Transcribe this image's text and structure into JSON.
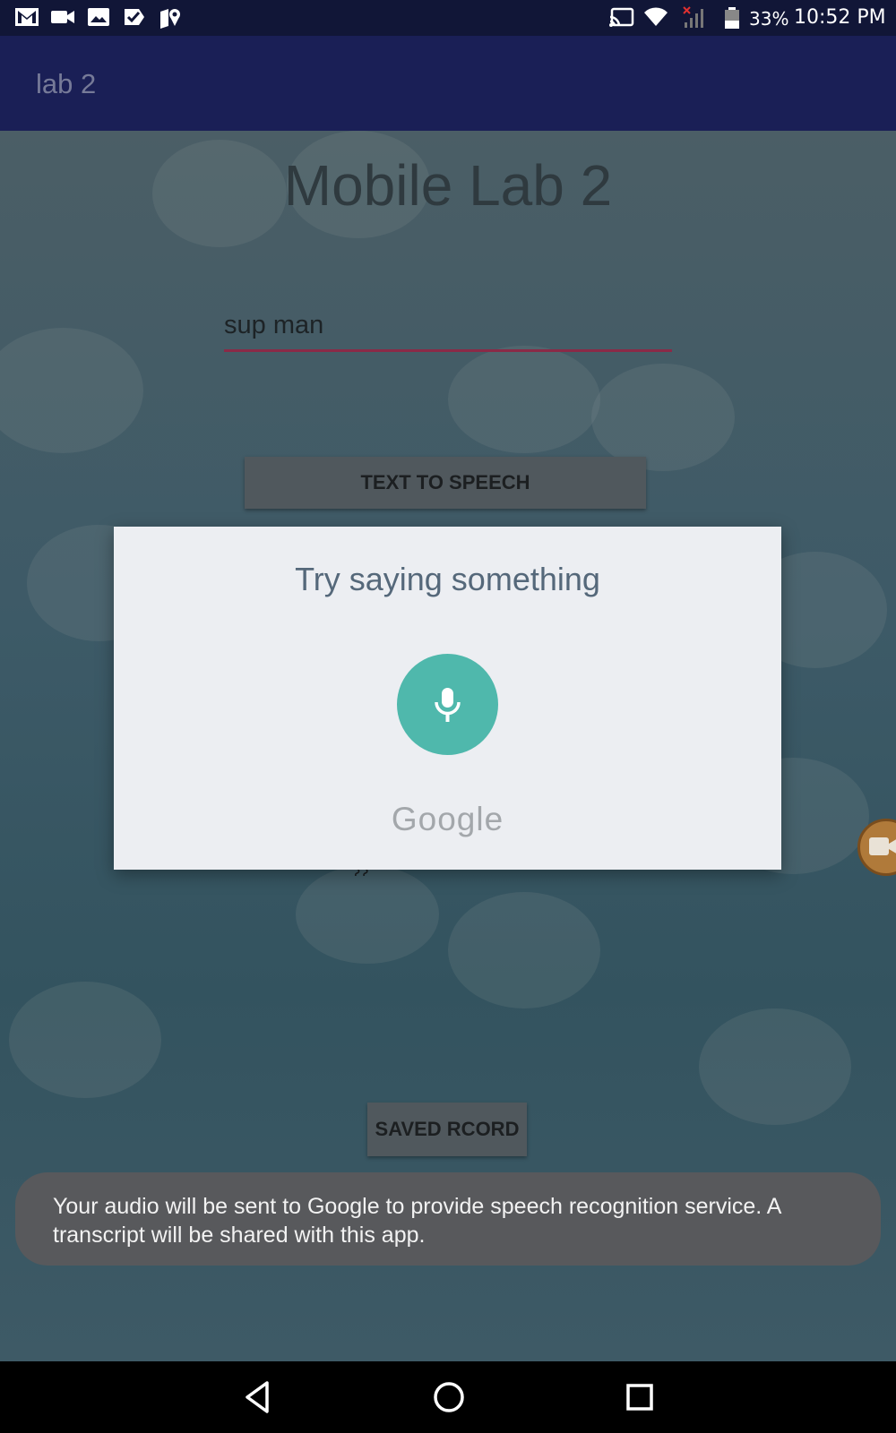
{
  "status_bar": {
    "battery_percent": "33%",
    "time": "10:52 PM",
    "left_icons": [
      "gmail-icon",
      "video-icon",
      "photo-icon",
      "check-icon",
      "maps-icon"
    ],
    "right_icons": [
      "cast-icon",
      "wifi-icon",
      "signal-icon",
      "battery-icon"
    ]
  },
  "app_bar": {
    "title": "lab 2"
  },
  "main": {
    "title": "Mobile Lab 2",
    "input_value": "sup man",
    "tts_button": "TEXT TO SPEECH",
    "saved_button": "SAVED RCORD"
  },
  "dialog": {
    "title": "Try saying something",
    "mic_icon": "mic-icon",
    "brand": "Google"
  },
  "toast": {
    "message": "Your audio will be sent to Google to provide speech recognition service. A transcript will be shared with this app."
  },
  "colors": {
    "status_bar": "#111637",
    "app_bar": "#1a1f56",
    "mic_button": "#4fb8ac",
    "input_underline": "#8a2a47"
  },
  "nav_bar": {
    "buttons": [
      "back-icon",
      "home-icon",
      "recents-icon"
    ]
  }
}
